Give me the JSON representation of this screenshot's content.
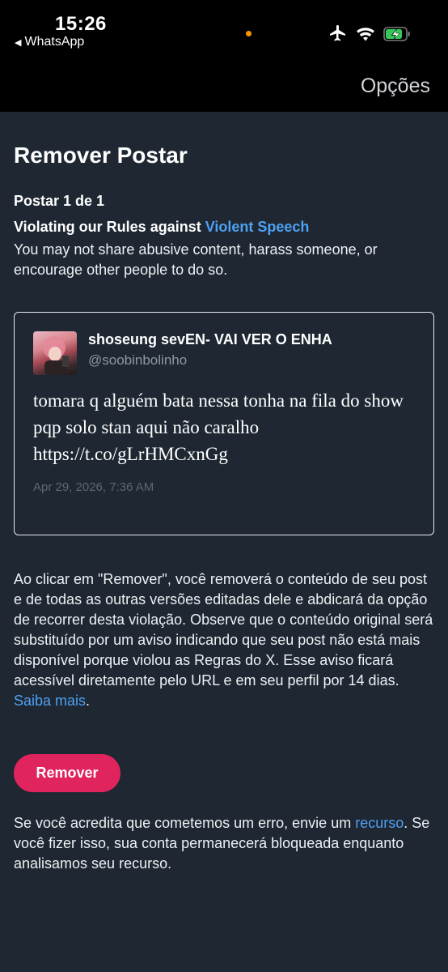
{
  "status_bar": {
    "time": "15:26",
    "back_app": "WhatsApp",
    "icons": [
      "airplane-icon",
      "wifi-icon",
      "battery-charging-icon"
    ]
  },
  "navbar": {
    "options_label": "Opções"
  },
  "main": {
    "title": "Remover Postar",
    "post_count": "Postar 1 de 1",
    "violation_prefix": "Violating our Rules against ",
    "violation_link": "Violent Speech",
    "violation_desc": "You may not share abusive content, harass someone, or encourage other people to do so."
  },
  "tweet": {
    "author_name": "shoseung sevEN- VAI VER O ENHA",
    "author_handle": "@soobinbolinho",
    "text": "tomara q alguém bata nessa tonha na fila do show pqp solo stan aqui não caralho https://t.co/gLrHMCxnGg",
    "date": "Apr 29, 2026, 7:36 AM"
  },
  "removal": {
    "text": "Ao clicar em \"Remover\", você removerá o conteúdo de seu post e de todas as outras versões editadas dele e abdicará da opção de recorrer desta violação. Observe que o conteúdo original será substituído por um aviso indicando que seu post não está mais disponível porque violou as Regras do X. Esse aviso ficará acessível diretamente pelo URL e em seu perfil por 14 dias. ",
    "learn_more_link": "Saiba mais",
    "suffix": ".",
    "button_label": "Remover"
  },
  "appeal": {
    "prefix": "Se você acredita que cometemos um erro, envie um ",
    "link": "recurso",
    "suffix": ". Se você fizer isso, sua conta permanecerá bloqueada enquanto analisamos seu recurso."
  },
  "colors": {
    "background": "#1e2732",
    "link": "#4ea1f3",
    "button": "#e0245e",
    "bar": "#000000"
  }
}
